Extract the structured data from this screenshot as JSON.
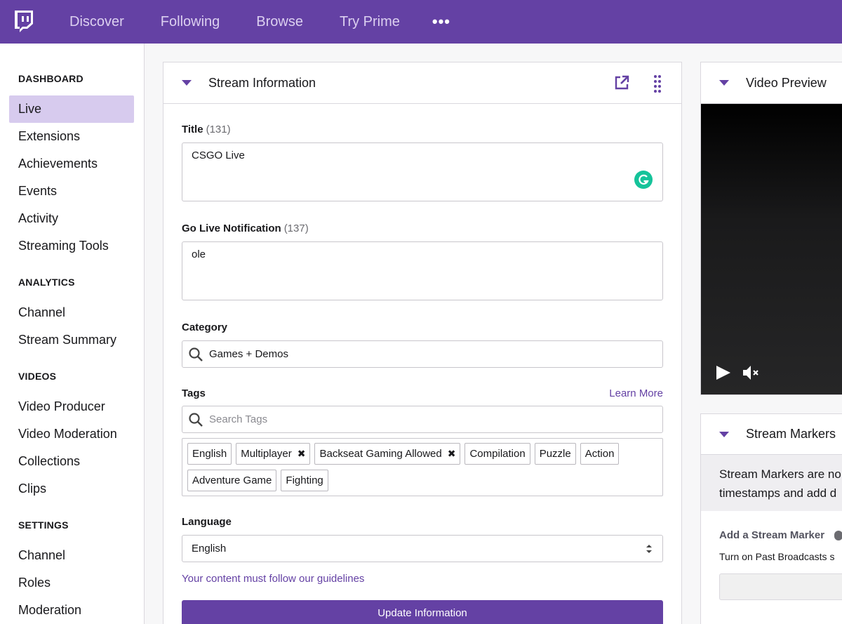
{
  "topbar": {
    "nav": [
      "Discover",
      "Following",
      "Browse",
      "Try Prime"
    ],
    "more": "•••"
  },
  "sidebar": {
    "sections": [
      {
        "title": "DASHBOARD",
        "items": [
          "Live",
          "Extensions",
          "Achievements",
          "Events",
          "Activity",
          "Streaming Tools"
        ]
      },
      {
        "title": "ANALYTICS",
        "items": [
          "Channel",
          "Stream Summary"
        ]
      },
      {
        "title": "VIDEOS",
        "items": [
          "Video Producer",
          "Video Moderation",
          "Collections",
          "Clips"
        ]
      },
      {
        "title": "SETTINGS",
        "items": [
          "Channel",
          "Roles",
          "Moderation"
        ]
      }
    ],
    "active_item": "Live"
  },
  "stream_info": {
    "header": "Stream Information",
    "title_label": "Title",
    "title_count": "(131)",
    "title_value": "CSGO Live",
    "notif_label": "Go Live Notification",
    "notif_count": "(137)",
    "notif_value": "ole",
    "category_label": "Category",
    "category_value": "Games + Demos",
    "tags_label": "Tags",
    "learn_more": "Learn More",
    "tags_placeholder": "Search Tags",
    "tags": [
      {
        "label": "English",
        "removable": false
      },
      {
        "label": "Multiplayer",
        "removable": true
      },
      {
        "label": "Backseat Gaming Allowed",
        "removable": true
      },
      {
        "label": "Compilation",
        "removable": false
      },
      {
        "label": "Puzzle",
        "removable": false
      },
      {
        "label": "Action",
        "removable": false
      },
      {
        "label": "Adventure Game",
        "removable": false
      },
      {
        "label": "Fighting",
        "removable": false
      }
    ],
    "language_label": "Language",
    "language_value": "English",
    "guidelines": "Your content must follow our guidelines",
    "update_button": "Update Information"
  },
  "video_preview": {
    "header": "Video Preview"
  },
  "stream_markers": {
    "header": "Stream Markers",
    "info_line1": "Stream Markers are no",
    "info_line2": "timestamps and add d",
    "add_label": "Add a Stream Marker",
    "past_broadcasts": "Turn on Past Broadcasts s"
  },
  "colors": {
    "brand": "#6441a4",
    "active_bg": "#d7cbee",
    "grammarly": "#15c39a"
  },
  "icons": [
    "twitch-logo-icon",
    "caret-down-icon",
    "popout-icon",
    "drag-handle-icon",
    "grammarly-icon",
    "search-icon",
    "select-arrows-icon",
    "remove-tag-icon",
    "play-icon",
    "mute-icon",
    "info-icon"
  ]
}
